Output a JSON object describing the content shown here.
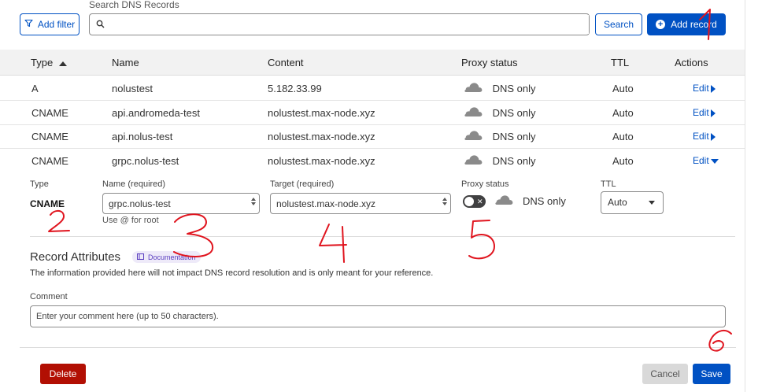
{
  "toolbar": {
    "add_filter_label": "Add filter",
    "search_label": "Search DNS Records",
    "search_value": "",
    "search_button_label": "Search",
    "add_record_label": "Add record"
  },
  "table": {
    "headers": {
      "type": "Type",
      "name": "Name",
      "content": "Content",
      "proxy_status": "Proxy status",
      "ttl": "TTL",
      "actions": "Actions"
    },
    "sort_icon": "sort-ascending-icon",
    "rows": [
      {
        "type": "A",
        "name": "nolustest",
        "content": "5.182.33.99",
        "proxy": "DNS only",
        "ttl": "Auto",
        "action": "Edit"
      },
      {
        "type": "CNAME",
        "name": "api.andromeda-test",
        "content": "nolustest.max-node.xyz",
        "proxy": "DNS only",
        "ttl": "Auto",
        "action": "Edit"
      },
      {
        "type": "CNAME",
        "name": "api.nolus-test",
        "content": "nolustest.max-node.xyz",
        "proxy": "DNS only",
        "ttl": "Auto",
        "action": "Edit"
      },
      {
        "type": "CNAME",
        "name": "grpc.nolus-test",
        "content": "nolustest.max-node.xyz",
        "proxy": "DNS only",
        "ttl": "Auto",
        "action": "Edit"
      }
    ]
  },
  "edit_form": {
    "type_label": "Type",
    "type_value": "CNAME",
    "name_label": "Name (required)",
    "name_value": "grpc.nolus-test",
    "name_hint": "Use @ for root",
    "target_label": "Target (required)",
    "target_value": "nolustest.max-node.xyz",
    "proxy_label": "Proxy status",
    "proxy_value": "DNS only",
    "proxy_enabled": false,
    "ttl_label": "TTL",
    "ttl_value": "Auto",
    "attributes_title": "Record Attributes",
    "documentation_label": "Documentation",
    "attributes_description": "The information provided here will not impact DNS record resolution and is only meant for your reference.",
    "comment_label": "Comment",
    "comment_placeholder": "Enter your comment here (up to 50 characters).",
    "delete_label": "Delete",
    "cancel_label": "Cancel",
    "save_label": "Save"
  },
  "annotations": [
    "1",
    "2",
    "3",
    "4",
    "5",
    "6"
  ],
  "colors": {
    "primary": "#0051c3",
    "danger": "#b20f03",
    "annotation": "#e0141e",
    "cloud_grey": "#8a8a8a"
  }
}
